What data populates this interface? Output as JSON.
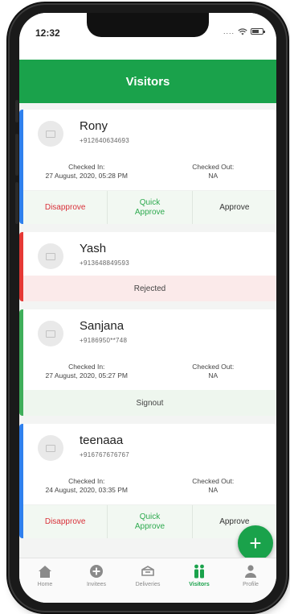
{
  "status_bar": {
    "time": "12:32",
    "dots": "...."
  },
  "header": {
    "title": "Visitors"
  },
  "labels": {
    "checked_in": "Checked In:",
    "checked_out": "Checked Out:",
    "disapprove": "Disapprove",
    "quick_approve_line1": "Quick",
    "quick_approve_line2": "Approve",
    "approve": "Approve"
  },
  "visitors": [
    {
      "name": "Rony",
      "phone": "+912640634693",
      "checked_in": "27 August, 2020, 05:28 PM",
      "checked_out": "NA",
      "accent": "#2f80ed"
    },
    {
      "name": "Yash",
      "phone": "+913648849593",
      "status": "Rejected",
      "accent": "#e53935"
    },
    {
      "name": "Sanjana",
      "phone": "+9186950**748",
      "checked_in": "27 August, 2020, 05:27 PM",
      "checked_out": "NA",
      "status": "Signout",
      "accent": "#3fae5a"
    },
    {
      "name": "teenaaa",
      "phone": "+916767676767",
      "checked_in": "24 August, 2020, 03:35 PM",
      "checked_out": "NA",
      "accent": "#2f80ed"
    }
  ],
  "fab": {
    "icon": "plus-icon",
    "symbol": "+"
  },
  "tabs": [
    {
      "label": "Home",
      "icon": "home-icon"
    },
    {
      "label": "Invitees",
      "icon": "add-circle-icon"
    },
    {
      "label": "Deliveries",
      "icon": "delivery-icon"
    },
    {
      "label": "Visitors",
      "icon": "visitors-icon",
      "active": true
    },
    {
      "label": "Profile",
      "icon": "profile-icon"
    }
  ],
  "colors": {
    "brand": "#1aa24b",
    "disapprove": "#d9313a",
    "tab_inactive": "#8a8a8a"
  }
}
